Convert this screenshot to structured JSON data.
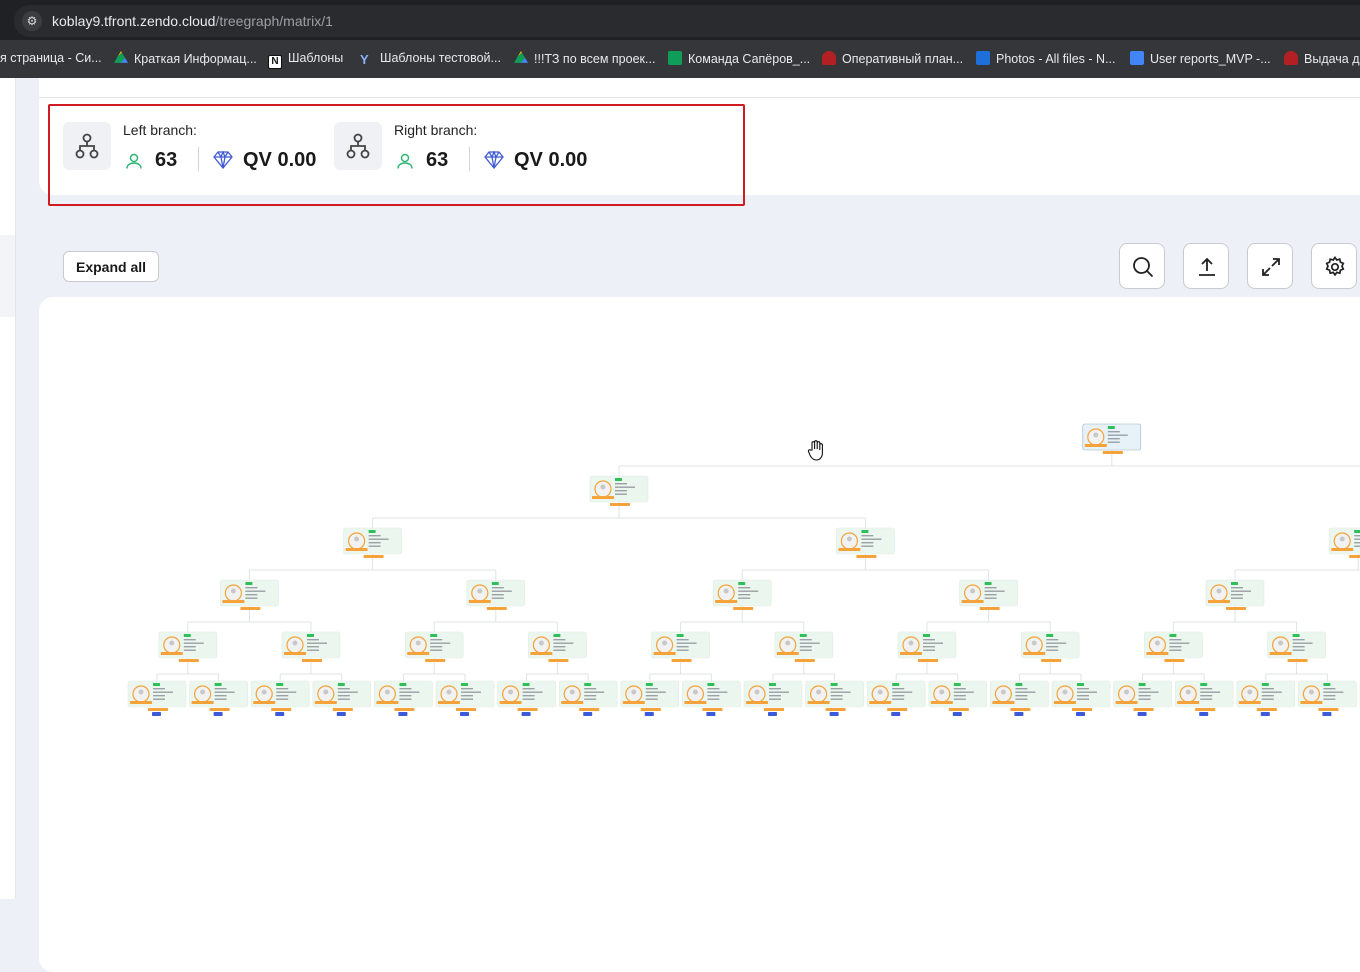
{
  "browser": {
    "url_host": "koblay9.tfront.zendo.cloud",
    "url_path": "/treegraph/matrix/1"
  },
  "bookmarks": [
    {
      "label": "я страница - Си...",
      "icon": "none",
      "color": ""
    },
    {
      "label": "Краткая Информац...",
      "icon": "drive-icon",
      "color": "#f4b400"
    },
    {
      "label": "Шаблоны",
      "icon": "notion-icon",
      "color": "#ffffff"
    },
    {
      "label": "Шаблоны тестовой...",
      "icon": "yandex-icon",
      "color": "#4285f4"
    },
    {
      "label": "!!!ТЗ по всем проек...",
      "icon": "drive-icon",
      "color": "#0f9d58"
    },
    {
      "label": "Команда Сапёров_...",
      "icon": "sheets-icon",
      "color": "#0f9d58"
    },
    {
      "label": "Оперативный план...",
      "icon": "redmine-icon",
      "color": "#b32024"
    },
    {
      "label": "Photos - All files - N...",
      "icon": "folder-icon",
      "color": "#1e6fd9"
    },
    {
      "label": "User reports_MVP -...",
      "icon": "docs-icon",
      "color": "#4285f4"
    },
    {
      "label": "Выдача до",
      "icon": "redmine-icon",
      "color": "#b32024"
    }
  ],
  "branches": {
    "left": {
      "title": "Left branch:",
      "people": "63",
      "qv": "QV 0.00"
    },
    "right": {
      "title": "Right branch:",
      "people": "63",
      "qv": "QV 0.00"
    }
  },
  "toolbar": {
    "expand_all": "Expand all",
    "buttons": [
      "search-icon",
      "upload-icon",
      "fullscreen-icon",
      "settings-icon"
    ]
  },
  "tree": {
    "levels": 6,
    "node_badge": "New",
    "accent_color": "#f5a23a",
    "node_bg": "#eaf6ee",
    "badge_color": "#2fbf5a",
    "leaf_tag_color": "#3b5bdb"
  },
  "colors": {
    "highlight_border": "#d11a22",
    "green_icon": "#2fb573",
    "diamond_icon": "#3f5bd5"
  }
}
